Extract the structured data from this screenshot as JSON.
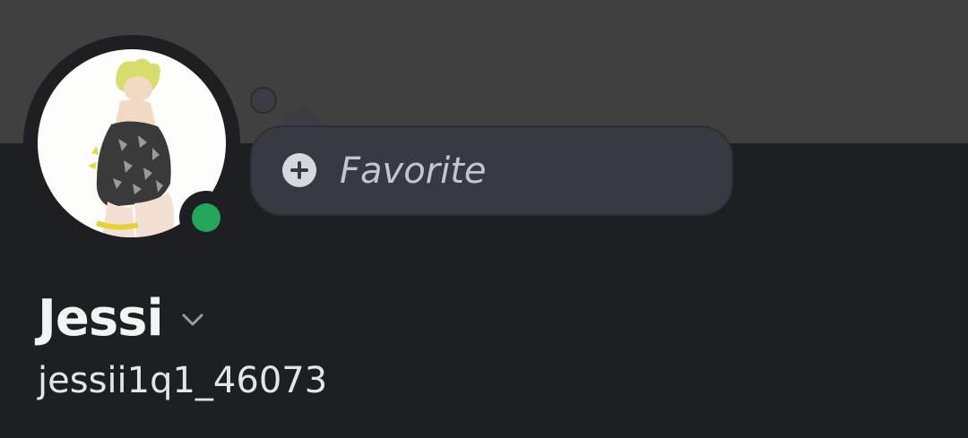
{
  "profile": {
    "display_name": "Jessi",
    "username": "jessii1q1_46073",
    "status_color": "#23a55a",
    "banner_color": "#404040",
    "background_color": "#1e1f23"
  },
  "status_bubble": {
    "placeholder": "Favorite",
    "icon": "plus-circle-icon"
  },
  "icons": {
    "name_dropdown": "chevron-down-icon"
  }
}
